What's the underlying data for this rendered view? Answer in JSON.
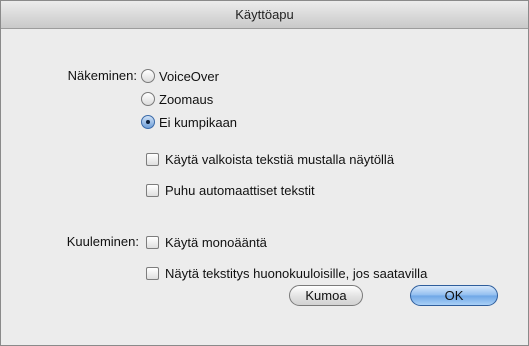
{
  "window": {
    "title": "Käyttöapu"
  },
  "vision": {
    "label": "Näkeminen:",
    "options": [
      {
        "label": "VoiceOver",
        "selected": false
      },
      {
        "label": "Zoomaus",
        "selected": false
      },
      {
        "label": "Ei kumpikaan",
        "selected": true
      }
    ],
    "checkboxes": [
      {
        "label": "Käytä valkoista tekstiä mustalla näytöllä",
        "checked": false
      },
      {
        "label": "Puhu automaattiset tekstit",
        "checked": false
      }
    ]
  },
  "hearing": {
    "label": "Kuuleminen:",
    "checkboxes": [
      {
        "label": "Käytä monoääntä",
        "checked": false
      },
      {
        "label": "Näytä tekstitys huonokuuloisille, jos saatavilla",
        "checked": false
      }
    ]
  },
  "buttons": {
    "cancel": "Kumoa",
    "ok": "OK"
  }
}
